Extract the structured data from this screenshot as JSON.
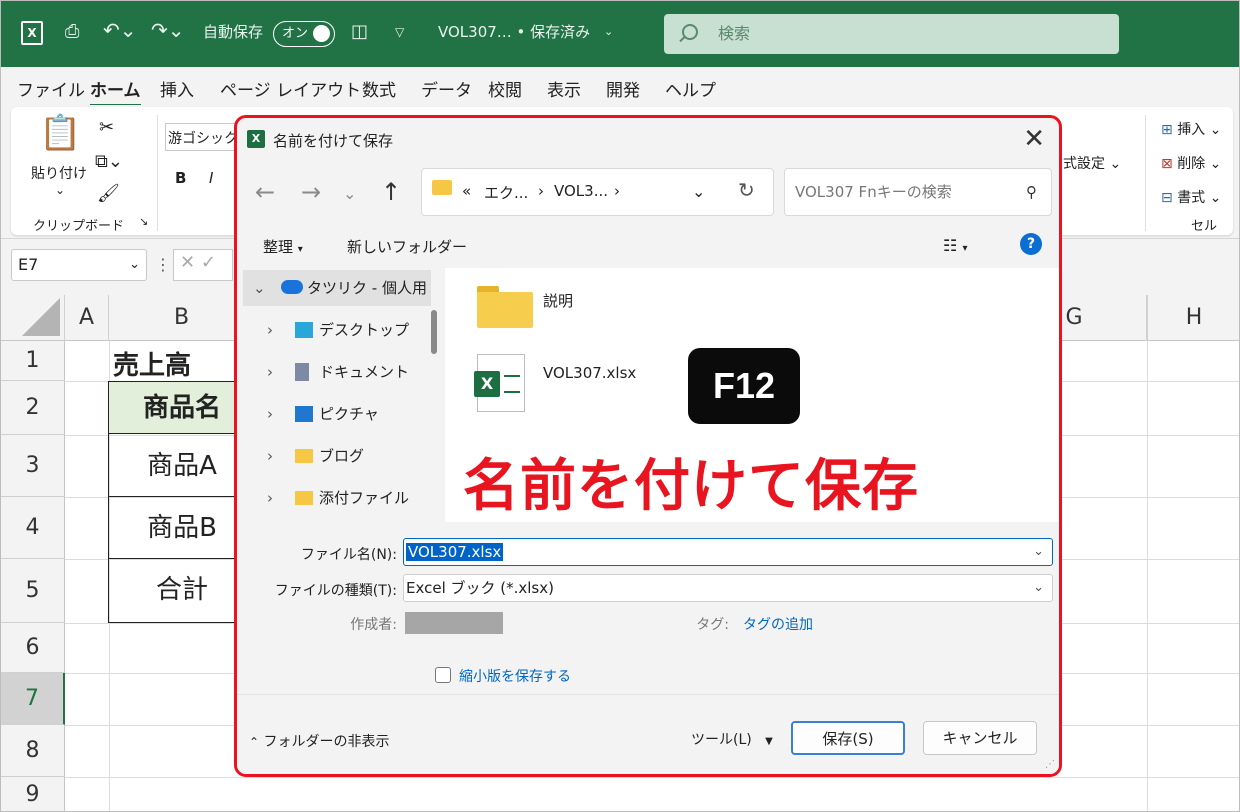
{
  "titlebar": {
    "logo": "X",
    "autosave_label": "自動保存",
    "autosave_toggle": "オン",
    "filename": "VOL307… • 保存済み",
    "search_placeholder": "検索"
  },
  "menu": [
    "ファイル",
    "ホーム",
    "挿入",
    "ページ レイアウト",
    "数式",
    "データ",
    "校閲",
    "表示",
    "開発",
    "ヘルプ"
  ],
  "ribbon": {
    "paste": "貼り付け",
    "clipboard_group": "クリップボード",
    "font_name": "游ゴシック",
    "bold": "B",
    "italic": "I",
    "format_settings": "式設定",
    "insert": "挿入",
    "delete": "削除",
    "format": "書式",
    "cells_group": "セル"
  },
  "formula": {
    "namebox": "E7"
  },
  "grid": {
    "columns": [
      "A",
      "B",
      "G",
      "H"
    ],
    "rows": [
      "1",
      "2",
      "3",
      "4",
      "5",
      "6",
      "7",
      "8",
      "9"
    ],
    "b1": "売上高",
    "b2": "商品名",
    "b3": "商品A",
    "b4": "商品B",
    "b5": "合計"
  },
  "dialog": {
    "title": "名前を付けて保存",
    "breadcrumb": [
      "«",
      "エク...",
      "VOL3...",
      "›"
    ],
    "search_placeholder": "VOL307 Fnキーの検索",
    "organize": "整理",
    "new_folder": "新しいフォルダー",
    "nav": [
      "タツリク - 個人用",
      "デスクトップ",
      "ドキュメント",
      "ピクチャ",
      "ブログ",
      "添付ファイル"
    ],
    "files": [
      "説明",
      "VOL307.xlsx"
    ],
    "filename_label": "ファイル名(N):",
    "filename_value": "VOL307.xlsx",
    "filetype_label": "ファイルの種類(T):",
    "filetype_value": "Excel ブック (*.xlsx)",
    "author_label": "作成者:",
    "tag_label": "タグ:",
    "tag_value": "タグの追加",
    "thumbnail_label": "縮小版を保存する",
    "hide_folders": "フォルダーの非表示",
    "tools": "ツール(L)",
    "save": "保存(S)",
    "cancel": "キャンセル"
  },
  "annotation": {
    "key": "F12",
    "caption": "名前を付けて保存"
  },
  "colors": {
    "excel_green": "#217346",
    "highlight_red": "#e8141f",
    "selection_blue": "#0063c7"
  }
}
